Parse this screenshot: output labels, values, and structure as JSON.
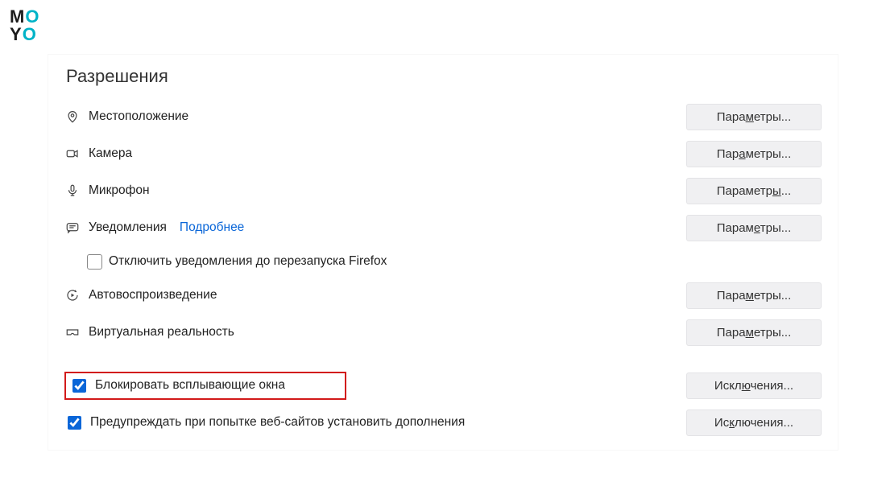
{
  "logo": {
    "m": "M",
    "o1": "O",
    "y": "Y",
    "o2": "O"
  },
  "section_title": "Разрешения",
  "items": {
    "location": "Местоположение",
    "camera": "Камера",
    "microphone": "Микрофон",
    "notifications": "Уведомления",
    "notifications_more": "Подробнее",
    "notifications_disable": "Отключить уведомления до перезапуска Firefox",
    "autoplay": "Автовоспроизведение",
    "vr": "Виртуальная реальность",
    "block_popups": "Блокировать всплывающие окна",
    "warn_addons": "Предупреждать при попытке веб-сайтов установить дополнения"
  },
  "buttons": {
    "params_pre": "Пара",
    "params_ul": "м",
    "params_post": "етры...",
    "params2_pre": "Параметр",
    "params2_ul": "ы",
    "params2_post": "...",
    "params3_pre": "Парам",
    "params3_ul": "е",
    "params3_post": "тры...",
    "params_a_pre": "Пар",
    "params_a_ul": "а",
    "params_a_post": "метры...",
    "excl_pre": "Искл",
    "excl_ul": "ю",
    "excl_post": "чения...",
    "excl2_pre": "Ис",
    "excl2_ul": "к",
    "excl2_post": "лючения..."
  },
  "sub_labels": {
    "disable_pre": "Откл",
    "disable_ul": "ю",
    "disable_post": "чить уведомления до перезапуска Firefox",
    "block_pre": "Бл",
    "block_ul": "о",
    "block_post": "кировать всплывающие окна"
  }
}
